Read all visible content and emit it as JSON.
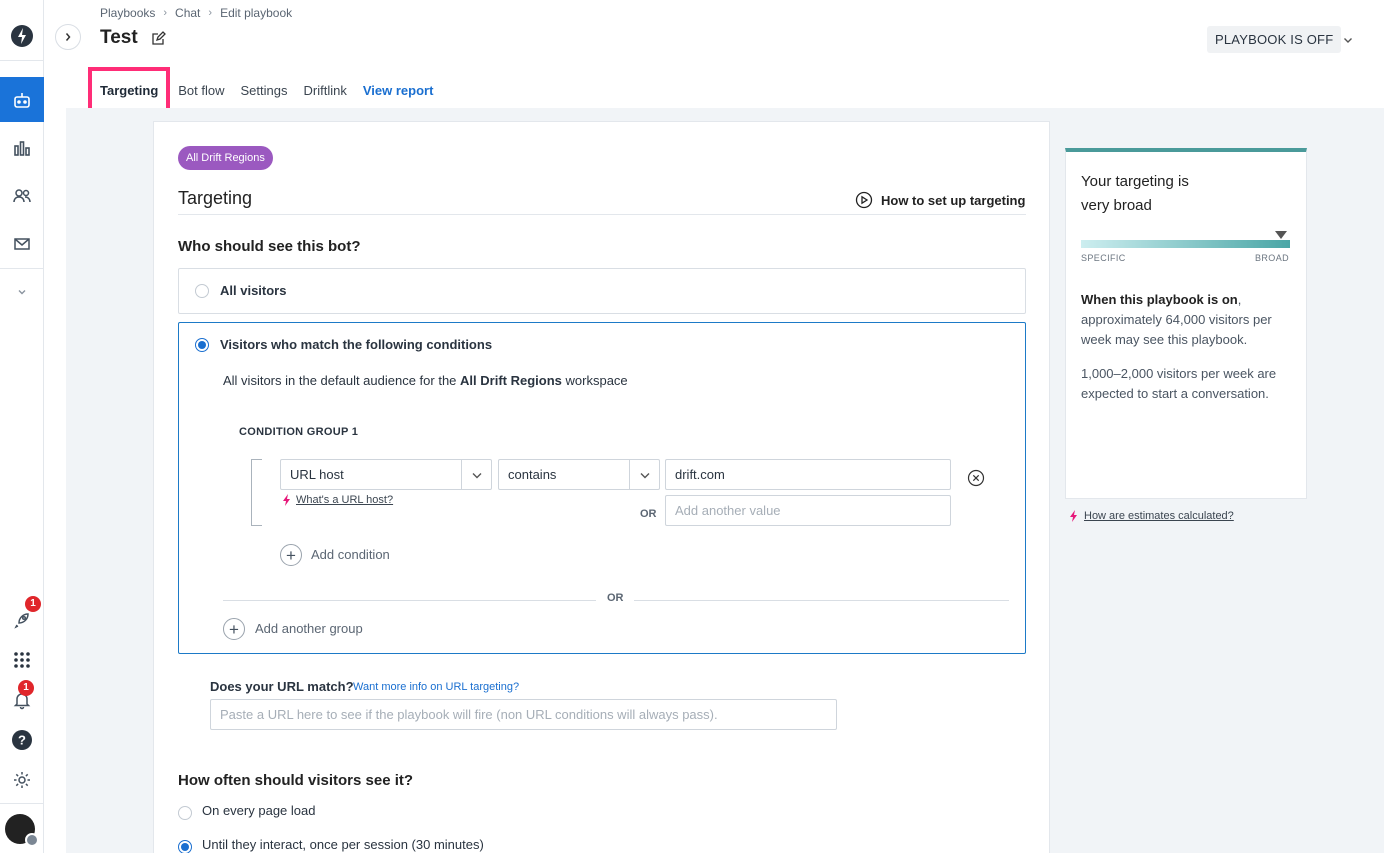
{
  "breadcrumb": [
    "Playbooks",
    "Chat",
    "Edit playbook"
  ],
  "page_title": "Test",
  "status_button": "PLAYBOOK IS OFF",
  "tabs": [
    {
      "label": "Targeting",
      "active": true
    },
    {
      "label": "Bot flow"
    },
    {
      "label": "Settings"
    },
    {
      "label": "Driftlink"
    },
    {
      "label": "View report",
      "link": true
    }
  ],
  "rail": {
    "badge_launch": "1",
    "badge_notifications": "1"
  },
  "region_pill": "All Drift Regions",
  "section_title": "Targeting",
  "how_to_link": "How to set up targeting",
  "who_question": "Who should see this bot?",
  "option_all": "All visitors",
  "option_conditions": "Visitors who match the following conditions",
  "audience_prefix": "All visitors in the default audience for the",
  "audience_workspace": "All Drift Regions",
  "audience_suffix": "workspace",
  "condition_group_title": "CONDITION GROUP 1",
  "condition": {
    "field": "URL host",
    "operator": "contains",
    "value": "drift.com",
    "help_link": "What's a URL host?",
    "or_label": "OR",
    "another_value_placeholder": "Add another value"
  },
  "add_condition": "Add condition",
  "group_or": "OR",
  "add_group": "Add another group",
  "url_match_label": "Does your URL match?",
  "url_match_link": "Want more info on URL targeting?",
  "url_match_placeholder": "Paste a URL here to see if the playbook will fire (non URL conditions will always pass).",
  "frequency_question": "How often should visitors see it?",
  "frequency_options": [
    {
      "label": "On every page load",
      "selected": false
    },
    {
      "label": "Until they interact, once per session (30 minutes)",
      "selected": true
    }
  ],
  "estimate_panel": {
    "title": "Your targeting is very broad",
    "meter_left": "SPECIFIC",
    "meter_right": "BROAD",
    "meter_level": 0.95,
    "text1_bold": "When this playbook is on",
    "text1_rest": ", approximately 64,000 visitors per week may see this playbook.",
    "text2": "1,000–2,000 visitors per week are expected to start a conversation.",
    "accent_color": "#4a9a9a"
  },
  "estimates_link": "How are estimates calculated?"
}
